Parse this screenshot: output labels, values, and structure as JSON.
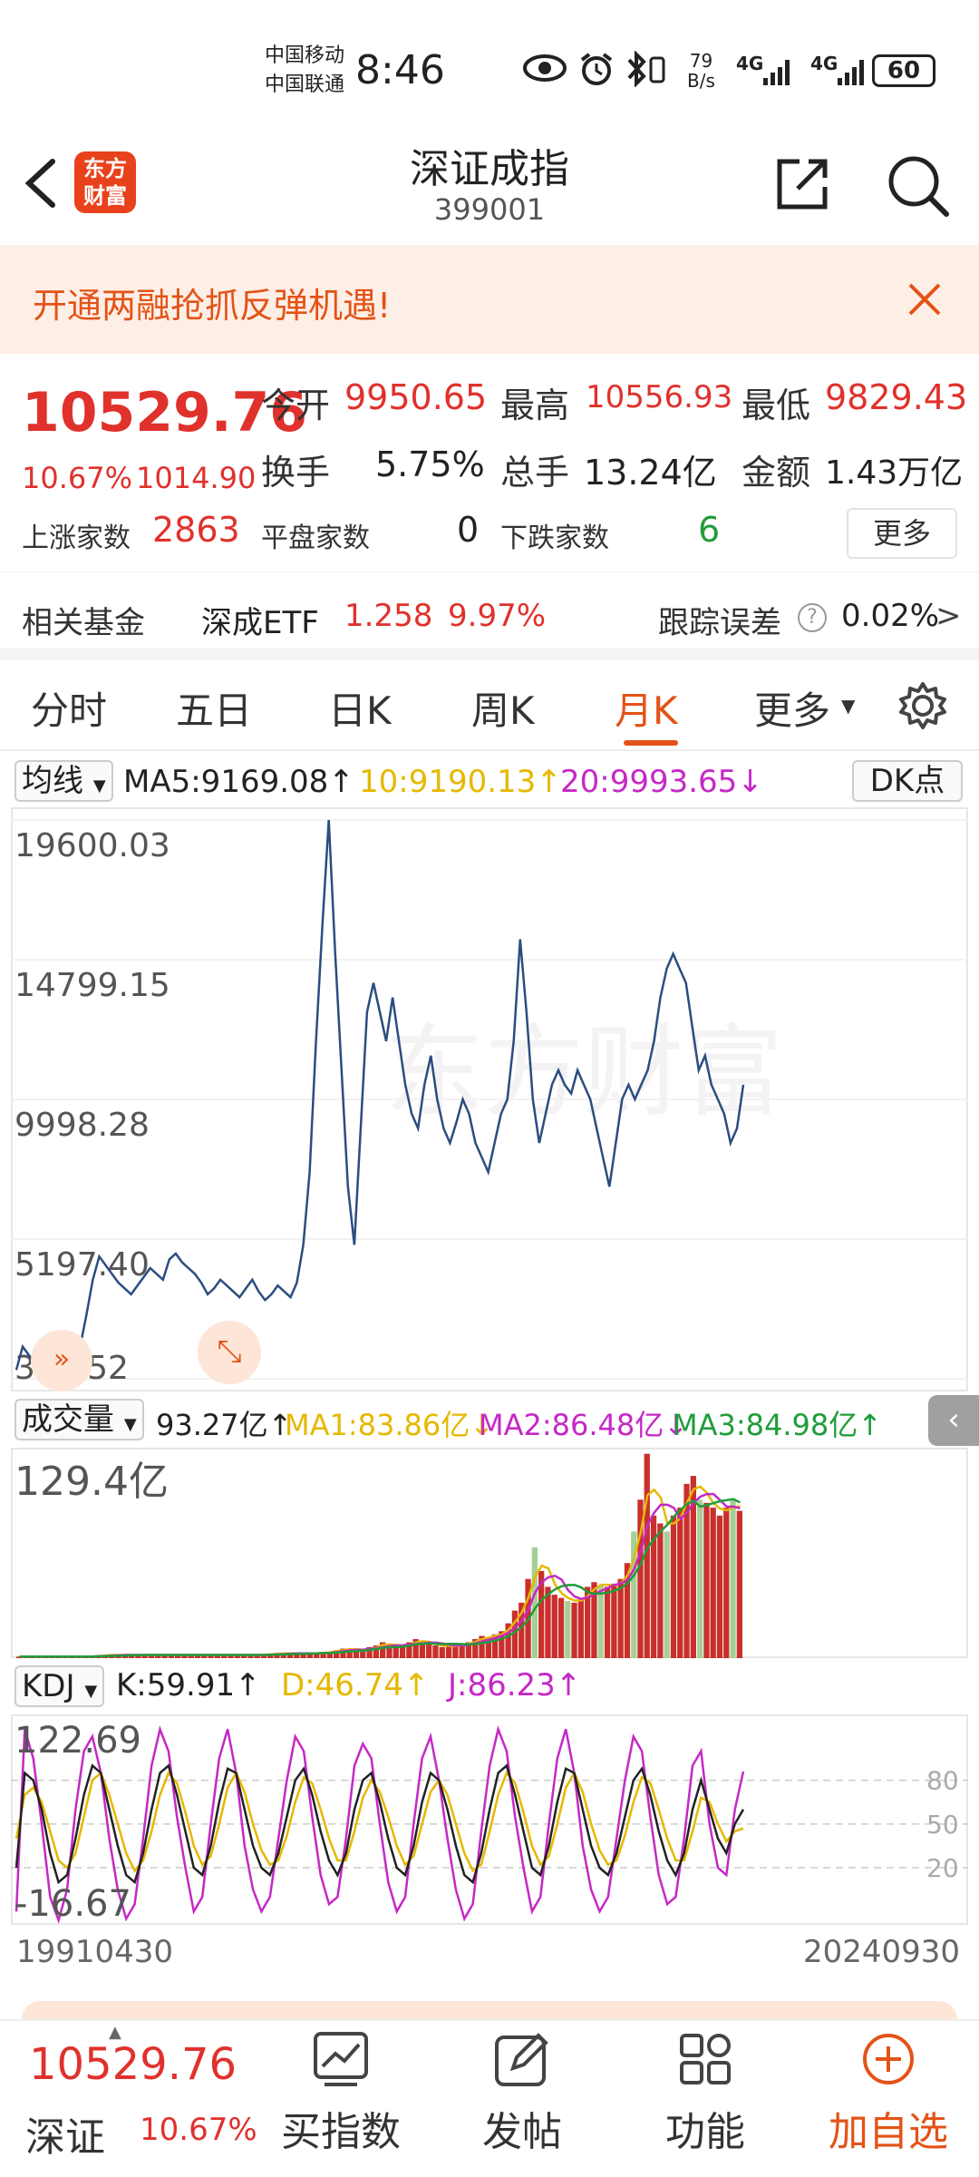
{
  "status": {
    "carrier1": "中国移动",
    "carrier2": "中国联通",
    "time": "8:46",
    "net_speed_top": "79",
    "net_speed_bottom": "B/s",
    "signal1": "4G",
    "signal2": "4G",
    "battery": "60"
  },
  "nav": {
    "logo_line1": "东方",
    "logo_line2": "财富",
    "title": "深证成指",
    "code": "399001"
  },
  "banner": {
    "text": "开通两融抢抓反弹机遇!"
  },
  "quote": {
    "price": "10529.76",
    "change_pct": "10.67%",
    "change_abs": "1014.90",
    "open_label": "今开",
    "open": "9950.65",
    "high_label": "最高",
    "high": "10556.93",
    "low_label": "最低",
    "low": "9829.43",
    "turnover_label": "换手",
    "turnover": "5.75%",
    "volume_label": "总手",
    "volume": "13.24亿",
    "amount_label": "金额",
    "amount": "1.43万亿",
    "up_label": "上涨家数",
    "up": "2863",
    "flat_label": "平盘家数",
    "flat": "0",
    "down_label": "下跌家数",
    "down": "6",
    "more": "更多"
  },
  "fund": {
    "label": "相关基金",
    "name": "深成ETF",
    "price": "1.258",
    "pct": "9.97%",
    "tracking_label": "跟踪误差",
    "tracking": "0.02%",
    "arrow": ">"
  },
  "tabs": [
    "分时",
    "五日",
    "日K",
    "周K",
    "月K",
    "更多"
  ],
  "tab_active": "月K",
  "ma_bar": {
    "select": "均线",
    "ma5": "MA5:9169.08",
    "ma10": "10:9190.13",
    "ma20": "20:9993.65",
    "dk": "DK点"
  },
  "volume_bar": {
    "select": "成交量",
    "vol": "93.27亿",
    "ma1": "MA1:83.86亿",
    "ma2": "MA2:86.48亿",
    "ma3": "MA3:84.98亿",
    "max_label": "129.4亿"
  },
  "kdj_bar": {
    "select": "KDJ",
    "k": "K:59.91",
    "d": "D:46.74",
    "j": "J:86.23",
    "top_label": "122.69",
    "bottom_label": "-16.67",
    "ref80": "80",
    "ref50": "50",
    "ref20": "20"
  },
  "date_start": "19910430",
  "date_end": "20240930",
  "bottom": {
    "price": "10529.76",
    "name": "深证",
    "pct": "10.67%",
    "buy": "买指数",
    "post": "发帖",
    "func": "功能",
    "add": "加自选"
  },
  "colors": {
    "accent": "#e35317",
    "up": "#e0312c",
    "down": "#1f9d3a",
    "price_line": "#2b4d80",
    "ma1": "#e6b800",
    "ma2": "#c628c6",
    "ma3": "#1f9d3a"
  },
  "chart_data": [
    {
      "type": "line",
      "name_hint": "main",
      "y_ticks": [
        "19600.03",
        "14799.15",
        "9998.28",
        "5197.40",
        "396.52"
      ],
      "ylim": [
        396.52,
        19600.03
      ],
      "series": [
        {
          "values": [
            700,
            1500,
            1200,
            900,
            600,
            800,
            500,
            400,
            600,
            1200,
            1500,
            2600,
            3800,
            4600,
            4300,
            4000,
            3700,
            3500,
            3300,
            3600,
            3900,
            4200,
            4000,
            3800,
            4500,
            4700,
            4400,
            4200,
            4000,
            3700,
            3300,
            3500,
            3800,
            3600,
            3400,
            3200,
            3500,
            3800,
            3400,
            3100,
            3300,
            3600,
            3400,
            3200,
            3700,
            5000,
            7500,
            12000,
            16000,
            19600,
            15000,
            11000,
            7000,
            5000,
            9000,
            13000,
            14000,
            13000,
            12000,
            13500,
            12000,
            10500,
            9500,
            9000,
            10500,
            11500,
            10000,
            9000,
            8500,
            9200,
            10000,
            9500,
            8500,
            8000,
            7500,
            8500,
            9500,
            10000,
            12000,
            15500,
            13000,
            10000,
            8500,
            9500,
            10500,
            11000,
            10500,
            10200,
            11000,
            10500,
            10000,
            9000,
            8000,
            7000,
            8500,
            10000,
            10500,
            10000,
            10500,
            11000,
            12000,
            13500,
            14500,
            15000,
            14500,
            14000,
            12500,
            11000,
            11500,
            10500,
            10000,
            9500,
            8500,
            9000,
            10500
          ]
        }
      ]
    },
    {
      "type": "bar",
      "name_hint": "volume",
      "ylim": [
        0,
        129.4
      ],
      "values": [
        1,
        1,
        1,
        1,
        1,
        1,
        1,
        1,
        1,
        1,
        1,
        1,
        2,
        2,
        2,
        2,
        2,
        2,
        2,
        2,
        2,
        2,
        2,
        2,
        2,
        2,
        2,
        2,
        2,
        2,
        2,
        2,
        2,
        2,
        2,
        2,
        2,
        2,
        3,
        3,
        3,
        3,
        3,
        3,
        3,
        3,
        4,
        4,
        5,
        6,
        6,
        5,
        5,
        7,
        8,
        10,
        8,
        7,
        8,
        10,
        12,
        10,
        9,
        8,
        7,
        8,
        8,
        9,
        10,
        12,
        14,
        13,
        15,
        17,
        22,
        30,
        35,
        50,
        70,
        55,
        45,
        40,
        38,
        36,
        35,
        38,
        45,
        48,
        46,
        45,
        47,
        50,
        60,
        80,
        100,
        129,
        90,
        85,
        80,
        90,
        95,
        110,
        115,
        100,
        98,
        95,
        90,
        95,
        100,
        93
      ]
    },
    {
      "type": "line",
      "name_hint": "kdj",
      "ylim": [
        -16.67,
        122.69
      ],
      "reference_lines": [
        80,
        50,
        20
      ],
      "series": [
        {
          "name": "K",
          "values": [
            20,
            85,
            80,
            60,
            30,
            10,
            15,
            40,
            70,
            90,
            85,
            60,
            35,
            15,
            10,
            30,
            60,
            85,
            90,
            70,
            45,
            20,
            15,
            35,
            65,
            88,
            85,
            60,
            35,
            20,
            15,
            30,
            55,
            80,
            88,
            70,
            45,
            25,
            15,
            30,
            60,
            80,
            85,
            65,
            40,
            20,
            15,
            35,
            65,
            85,
            80,
            60,
            35,
            15,
            10,
            30,
            60,
            85,
            90,
            70,
            45,
            20,
            15,
            35,
            65,
            88,
            85,
            60,
            35,
            20,
            15,
            30,
            55,
            80,
            88,
            70,
            45,
            25,
            15,
            30,
            60,
            80,
            60,
            40,
            30,
            50,
            60
          ]
        },
        {
          "name": "D",
          "values": [
            40,
            70,
            75,
            65,
            45,
            25,
            20,
            30,
            55,
            80,
            85,
            70,
            50,
            30,
            18,
            25,
            45,
            70,
            85,
            78,
            58,
            35,
            22,
            28,
            50,
            75,
            85,
            72,
            50,
            32,
            22,
            25,
            42,
            65,
            82,
            78,
            60,
            40,
            25,
            25,
            45,
            68,
            80,
            72,
            55,
            35,
            22,
            28,
            50,
            72,
            80,
            70,
            50,
            30,
            18,
            22,
            45,
            70,
            85,
            78,
            58,
            35,
            22,
            28,
            50,
            75,
            85,
            72,
            50,
            32,
            22,
            25,
            42,
            65,
            82,
            78,
            60,
            40,
            25,
            25,
            45,
            68,
            65,
            50,
            38,
            45,
            47
          ]
        },
        {
          "name": "J",
          "values": [
            -10,
            115,
            95,
            50,
            0,
            -16,
            5,
            60,
            100,
            110,
            85,
            40,
            5,
            -15,
            -5,
            40,
            90,
            115,
            100,
            55,
            20,
            -10,
            0,
            50,
            95,
            115,
            85,
            35,
            5,
            -10,
            0,
            40,
            80,
            110,
            100,
            55,
            15,
            -5,
            0,
            40,
            90,
            105,
            95,
            50,
            10,
            -10,
            0,
            50,
            95,
            110,
            80,
            40,
            5,
            -15,
            -5,
            45,
            90,
            115,
            100,
            55,
            20,
            -10,
            0,
            50,
            95,
            115,
            85,
            35,
            5,
            -10,
            0,
            40,
            80,
            110,
            100,
            55,
            15,
            -5,
            0,
            40,
            90,
            100,
            50,
            20,
            15,
            60,
            86
          ]
        }
      ]
    }
  ]
}
